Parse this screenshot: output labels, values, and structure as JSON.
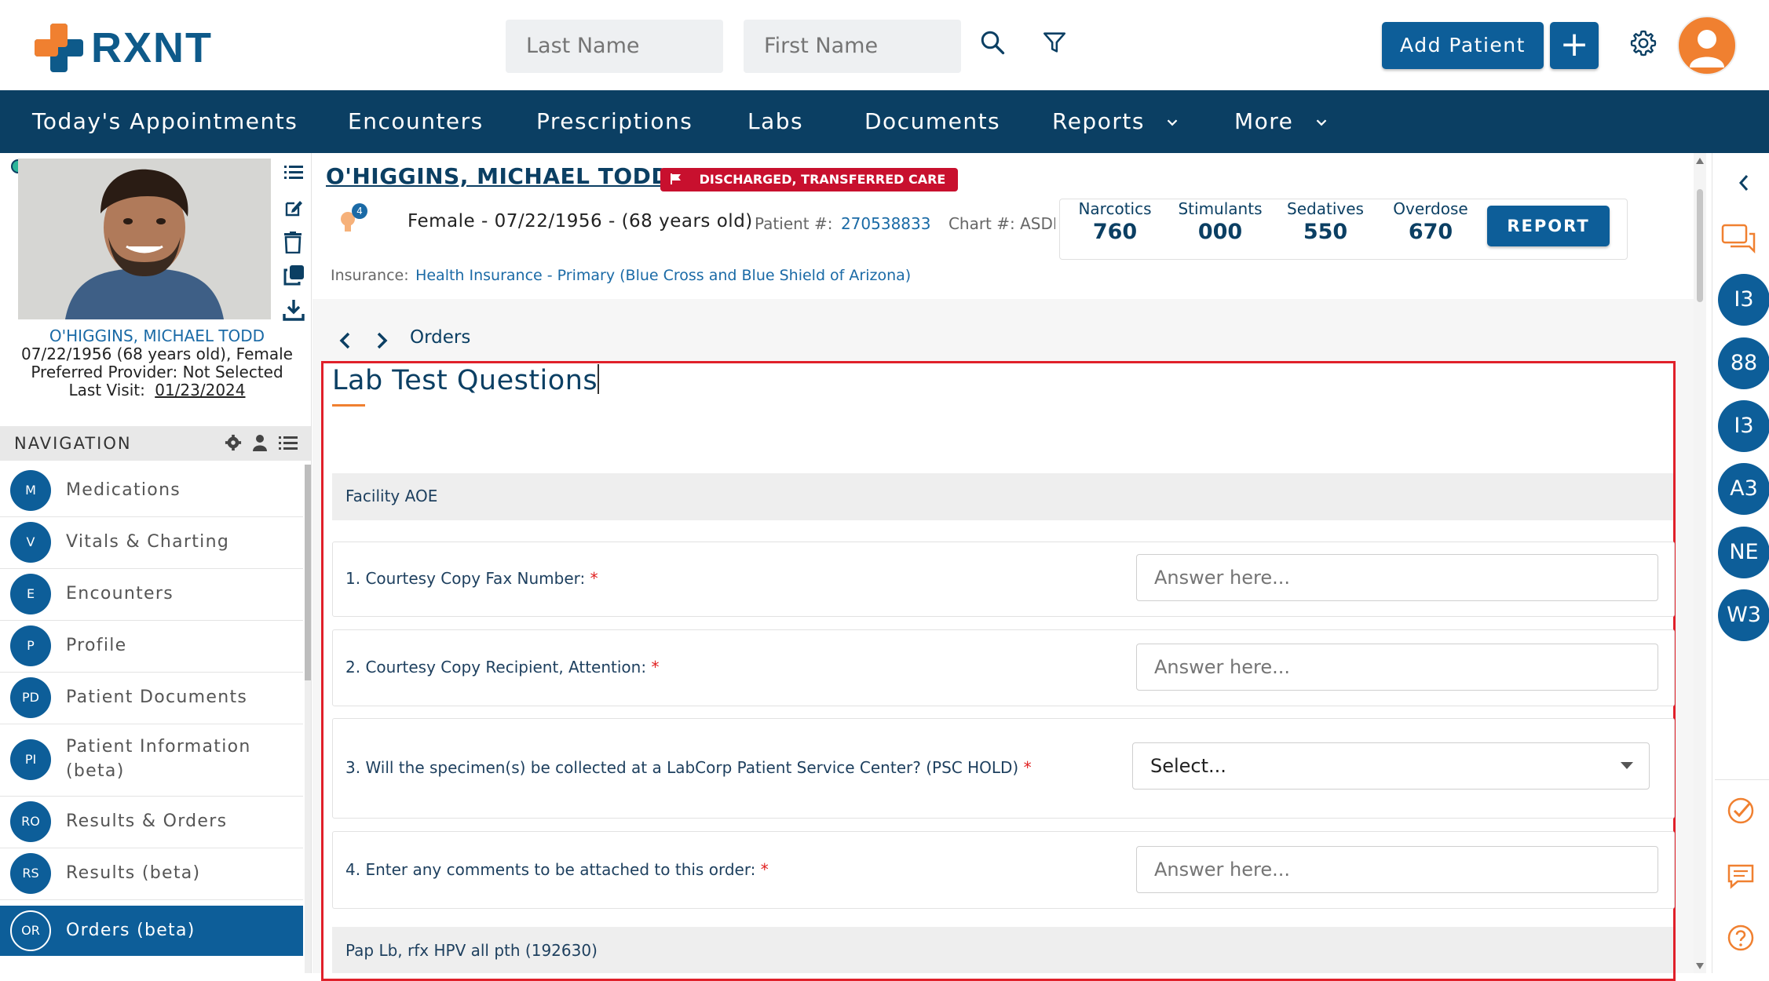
{
  "app": {
    "logo_text": "RXNT",
    "search": {
      "last_name_placeholder": "Last Name",
      "first_name_placeholder": "First Name"
    },
    "add_patient_label": "Add Patient",
    "add_icon": "+"
  },
  "nav": {
    "items": [
      {
        "label": "Today's Appointments"
      },
      {
        "label": "Encounters"
      },
      {
        "label": "Prescriptions"
      },
      {
        "label": "Labs"
      },
      {
        "label": "Documents"
      },
      {
        "label": "Reports"
      },
      {
        "label": "More"
      }
    ]
  },
  "patient_card": {
    "name": "O'HIGGINS, MICHAEL TODD",
    "dob_line": "07/22/1956 (68 years old), Female",
    "provider_line": "Preferred Provider: Not Selected",
    "last_visit_label": "Last Visit:",
    "last_visit_value": "01/23/2024"
  },
  "navigation": {
    "header": "NAVIGATION",
    "items": [
      {
        "abbr": "M",
        "label": "Medications"
      },
      {
        "abbr": "V",
        "label": "Vitals & Charting"
      },
      {
        "abbr": "E",
        "label": "Encounters"
      },
      {
        "abbr": "P",
        "label": "Profile"
      },
      {
        "abbr": "PD",
        "label": "Patient Documents"
      },
      {
        "abbr": "PI",
        "label": "Patient Information (beta)"
      },
      {
        "abbr": "RO",
        "label": "Results & Orders"
      },
      {
        "abbr": "RS",
        "label": "Results (beta)"
      },
      {
        "abbr": "OR",
        "label": "Orders (beta)"
      }
    ]
  },
  "patient_header": {
    "name": "O'HIGGINS, MICHAEL TODD",
    "status_badge": "DISCHARGED, TRANSFERRED CARE",
    "alert_count": "4",
    "demographics": "Female - 07/22/1956 - (68 years old)",
    "patient_num_label": "Patient #:",
    "patient_num_value": "270538833",
    "chart_label": "Chart #: ASDFGH",
    "insurance_label": "Insurance:",
    "insurance_value": "Health Insurance - Primary (Blue Cross and Blue Shield of Arizona)",
    "stats": [
      {
        "title": "Narcotics",
        "value": "760"
      },
      {
        "title": "Stimulants",
        "value": "000"
      },
      {
        "title": "Sedatives",
        "value": "550"
      },
      {
        "title": "Overdose",
        "value": "670"
      }
    ],
    "report_label": "REPORT"
  },
  "breadcrumb": {
    "current": "Orders"
  },
  "form": {
    "title": "Lab Test Questions",
    "sections": [
      {
        "title": "Facility AOE"
      },
      {
        "title": "Pap Lb, rfx HPV all pth (192630)"
      }
    ],
    "questions": [
      {
        "text": "1. Courtesy Copy Fax Number:",
        "required": "*",
        "placeholder": "Answer here..."
      },
      {
        "text": "2. Courtesy Copy Recipient, Attention:",
        "required": "*",
        "placeholder": "Answer here..."
      },
      {
        "text": "3. Will the specimen(s) be collected at a LabCorp Patient Service Center? (PSC HOLD)",
        "required": "*",
        "select_value": "Select..."
      },
      {
        "text": "4. Enter any comments to be attached to this order:",
        "required": "*",
        "placeholder": "Answer here..."
      }
    ]
  },
  "right_sidebar": {
    "circles": [
      "I3",
      "88",
      "I3",
      "A3",
      "NE",
      "W3"
    ]
  },
  "colors": {
    "primary": "#0d5e99",
    "navbar": "#0b3f63",
    "accent_orange": "#f08030",
    "badge_red": "#c8102e",
    "highlight_red": "#e0202a"
  }
}
